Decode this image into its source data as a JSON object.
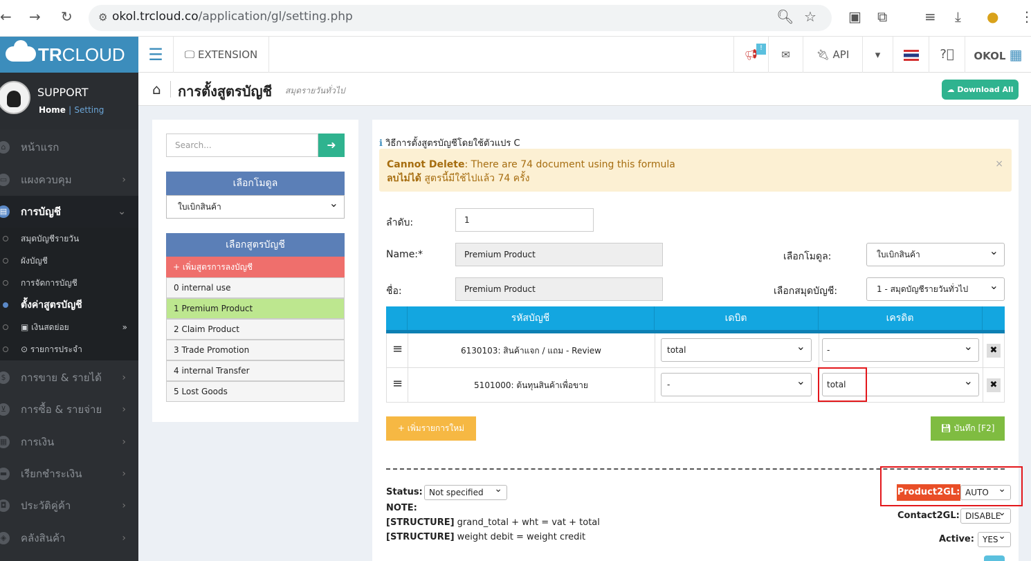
{
  "browser": {
    "domain": "okol.trcloud.co",
    "path": "/application/gl/setting.php"
  },
  "brand": {
    "bold": "TR",
    "rest": "CLOUD"
  },
  "topnav": {
    "extension": "EXTENSION",
    "badge": "!",
    "api": "API",
    "user": "OKOL"
  },
  "sidebar": {
    "user_name": "SUPPORT",
    "link_home": "Home",
    "link_sep": "|",
    "link_setting": "Setting",
    "items": [
      {
        "label": "หน้าแรก"
      },
      {
        "label": "แผงควบคุม"
      },
      {
        "label": "การบัญชี"
      },
      {
        "label": "การขาย & รายได้"
      },
      {
        "label": "การซื้อ & รายจ่าย"
      },
      {
        "label": "การเงิน"
      },
      {
        "label": "เรียกชำระเงิน"
      },
      {
        "label": "ประวัติคู่ค้า"
      },
      {
        "label": "คลังสินค้า"
      }
    ],
    "subitems": [
      {
        "label": "สมุดบัญชีรายวัน"
      },
      {
        "label": "ผังบัญชี"
      },
      {
        "label": "การจัดการบัญชี"
      },
      {
        "label": "ตั้งค่าสูตรบัญชี"
      },
      {
        "label": "เงินสดย่อย"
      },
      {
        "label": "รายการประจำ"
      }
    ]
  },
  "page": {
    "title": "การตั้งสูตรบัญชี",
    "subtitle": "สมุดรายวันทั่วไป",
    "download": "Download All"
  },
  "left": {
    "search_placeholder": "Search...",
    "module_header": "เลือกโมดูล",
    "module_value": "ใบเบิกสินค้า",
    "formula_header": "เลือกสูตรบัญชี",
    "add_formula": "+ เพิ่มสูตรการลงบัญชี",
    "formulas": [
      "0 internal use",
      "1 Premium Product",
      "2 Claim Product",
      "3 Trade Promotion",
      "4 internal Transfer",
      "5 Lost Goods"
    ]
  },
  "main": {
    "info": "วิธีการตั้งสูตรบัญชีโดยใช้ตัวแปร C",
    "alert_b1": "Cannot Delete",
    "alert_t1": ": There are 74 document using this formula",
    "alert_b2": "ลบไม่ได้",
    "alert_t2": " สูตรนี้มีใช้ไปแล้ว 74 ครั้ง",
    "close": "×",
    "order_label": "ลำดับ:",
    "order_value": "1",
    "name_label": "Name:*",
    "name_value": "Premium Product",
    "thname_label": "ชื่อ:",
    "thname_value": "Premium Product",
    "module_label": "เลือกโมดูล:",
    "module_value": "ใบเบิกสินค้า",
    "book_label": "เลือกสมุดบัญชี:",
    "book_value": "1 - สมุดบัญชีรายวันทั่วไป",
    "table": {
      "headers": [
        "รหัสบัญชี",
        "เดบิต",
        "เครดิต"
      ],
      "rows": [
        {
          "account": "6130103: สินค้าแจก / แถม - Review",
          "debit": "total",
          "credit": "-"
        },
        {
          "account": "5101000: ต้นทุนสินค้าเพื่อขาย",
          "debit": "-",
          "credit": "total"
        }
      ]
    },
    "add_row": "+ เพิ่มรายการใหม่",
    "save": "บันทึก [F2]",
    "status_label": "Status:",
    "status_value": "Not specified",
    "note": "NOTE:",
    "structure_tag": "[STRUCTURE]",
    "structure1": " grand_total + wht = vat + total",
    "structure2": " weight debit = weight credit",
    "product2gl_label": "Product2GL:",
    "product2gl_value": "AUTO",
    "contact2gl_label": "Contact2GL:",
    "contact2gl_value": "DISABLE",
    "active_label": "Active:",
    "active_value": "YES"
  },
  "colors": {
    "brand": "#3c8dbc",
    "panel_header": "#5b7fb7",
    "add_formula": "#ef6f6c",
    "selected": "#bde78f",
    "table_header": "#13a6e0",
    "alert": "#fcf0d3",
    "save": "#7fbc41",
    "add_row": "#f6b843",
    "highlight": "#e3171b",
    "product2gl": "#e94e27",
    "download": "#2fb38f"
  }
}
